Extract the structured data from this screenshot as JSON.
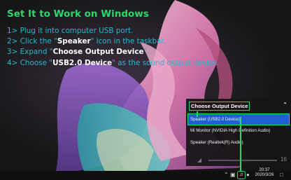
{
  "instructions": {
    "title": "Set It to Work on Windows",
    "steps": [
      {
        "prefix": "1> Plug it into computer USB port.",
        "highlight": "",
        "suffix": ""
      },
      {
        "prefix": "2> Click the \"",
        "highlight": "Speaker",
        "suffix": "\" icon in the taskbar."
      },
      {
        "prefix": "3> Expand \"",
        "highlight": "Choose Output Device",
        "suffix": "\"."
      },
      {
        "prefix": "4> Choose \"",
        "highlight": "USB2.0 Device",
        "suffix": "\" as the sound output device."
      }
    ]
  },
  "sound_panel": {
    "header": "Choose Output Device",
    "devices": [
      {
        "label": "Speaker (USB2.0 Device)",
        "selected": true
      },
      {
        "label": "Mi Monitor (NVIDIA High Definition Audio)",
        "selected": false
      },
      {
        "label": "Speaker (Realtek(R) Audio)",
        "selected": false
      }
    ],
    "volume": "16",
    "volume_icon": "speaker-muted-icon"
  },
  "taskbar": {
    "time": "20:37",
    "date": "2020/3/26"
  },
  "colors": {
    "accent_green": "#29d96b",
    "step_text": "#2ab8d0",
    "selected_bg": "#1f5fd0"
  }
}
